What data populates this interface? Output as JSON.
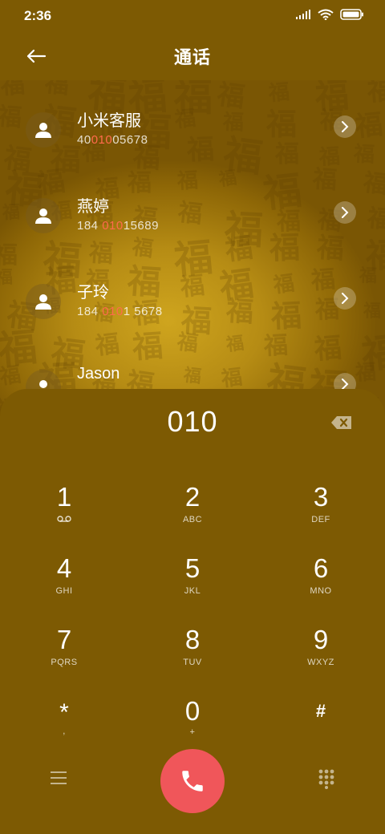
{
  "status_bar": {
    "time": "2:36"
  },
  "header": {
    "title": "通话"
  },
  "background_pattern_char": "福",
  "contacts": [
    {
      "name": "小米客服",
      "number_pre": "40",
      "number_hl": "010",
      "number_post": "05678"
    },
    {
      "name": "燕婷",
      "number_pre": "184 ",
      "number_hl": "010",
      "number_post": "15689"
    },
    {
      "name": "子玲",
      "number_pre": "184 ",
      "number_hl": "010",
      "number_post": "1 5678"
    },
    {
      "name": "Jason",
      "number_pre": "",
      "number_hl": "",
      "number_post": ""
    }
  ],
  "dialer": {
    "input": "010",
    "keys": [
      {
        "digit": "1",
        "sub": "voicemail-icon"
      },
      {
        "digit": "2",
        "sub": "ABC"
      },
      {
        "digit": "3",
        "sub": "DEF"
      },
      {
        "digit": "4",
        "sub": "GHI"
      },
      {
        "digit": "5",
        "sub": "JKL"
      },
      {
        "digit": "6",
        "sub": "MNO"
      },
      {
        "digit": "7",
        "sub": "PQRS"
      },
      {
        "digit": "8",
        "sub": "TUV"
      },
      {
        "digit": "9",
        "sub": "WXYZ"
      },
      {
        "digit": "*",
        "sub": ","
      },
      {
        "digit": "0",
        "sub": "+"
      },
      {
        "digit": "#",
        "sub": ""
      }
    ]
  },
  "colors": {
    "background": "#7d5a03",
    "call_button": "#f0565a",
    "highlight": "#ff6b4d"
  }
}
